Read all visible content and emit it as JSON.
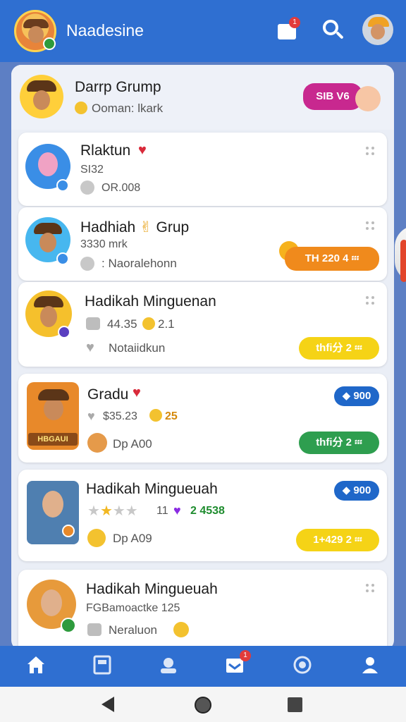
{
  "header": {
    "app_title": "Naadesine",
    "inbox_badge": "1",
    "icons": [
      "avatar-icon",
      "inbox-icon",
      "search-icon",
      "profile-icon"
    ]
  },
  "group_header": {
    "title": "Darrp Grump",
    "subtitle": "Ooman: lkark",
    "pill": "SIB V6"
  },
  "cards": [
    {
      "title": "Rlaktun",
      "line2": "SI32",
      "line3": "OR.008"
    },
    {
      "title": "Hadhiah",
      "title2": "Grup",
      "line2": "3330 mrk",
      "line3": ": Naoralehonn",
      "pill": "TH 220  4 ፡፡፡"
    },
    {
      "title": "Hadikah Minguenan",
      "line2": "44.35",
      "line2b": "2.1",
      "line3": "Notaiidkun",
      "pill": "thfi分 2 ፡፡፡"
    },
    {
      "title": "Gradu",
      "line2": "$35.23",
      "line2b": "25",
      "line3": "Dp A00",
      "badge": "900",
      "pill": "thfi分 2 ፡፡፡",
      "game_label": "HBGAUI"
    },
    {
      "title": "Hadikah Mingueuah",
      "stars_filled": 1,
      "stars_total": 4,
      "line2b": "11",
      "line2c": "2 4538",
      "line3": "Dp A09",
      "badge": "900",
      "pill": "1+429 2 ፡፡፡"
    },
    {
      "title": "Hadikah Mingueuah",
      "line2": "FGBamoactke 125",
      "line3": "Neraluon"
    }
  ],
  "bottom_nav": {
    "items": [
      "home-icon",
      "news-icon",
      "group-icon",
      "inbox-icon",
      "chat-icon",
      "profile-icon"
    ],
    "badge": "1"
  },
  "colors": {
    "brand": "#2f6fd1",
    "pill_orange": "#f08a1c",
    "pill_yellow": "#f5d316",
    "pill_green": "#2e9e4f",
    "pill_blue": "#1f67c9",
    "pill_magenta": "#c8288f"
  }
}
